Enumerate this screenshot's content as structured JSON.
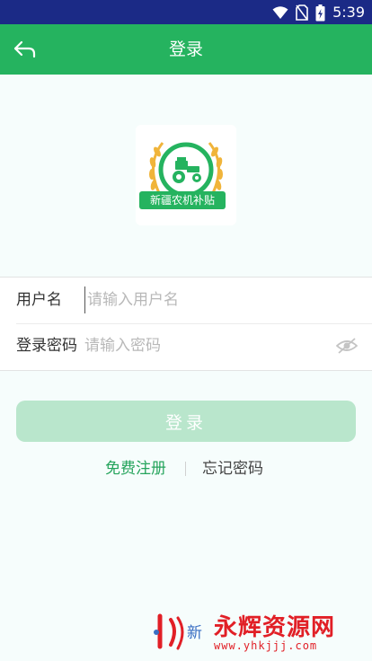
{
  "status_bar": {
    "time": "5:39",
    "icons": [
      "wifi-icon",
      "no-sim-icon",
      "battery-charging-icon"
    ]
  },
  "app_bar": {
    "title": "登录",
    "back_icon": "back-arrow-icon"
  },
  "logo": {
    "text": "新疆农机补贴"
  },
  "form": {
    "username_label": "用户名",
    "username_placeholder": "请输入用户名",
    "username_value": "",
    "password_label": "登录密码",
    "password_placeholder": "请输入密码",
    "password_value": "",
    "toggle_icon": "eye-icon"
  },
  "login_button": {
    "label": "登录"
  },
  "links": {
    "register": "免费注册",
    "forgot": "忘记密码"
  },
  "watermark": {
    "brand": "永辉资源网",
    "url": "www.yhkjjj.com",
    "logo_text": "新"
  },
  "colors": {
    "status_bar": "#1b2a86",
    "primary": "#25b35f",
    "button_disabled": "#b9e6cc",
    "link_green": "#25a45c",
    "watermark_red": "#e11f26"
  }
}
